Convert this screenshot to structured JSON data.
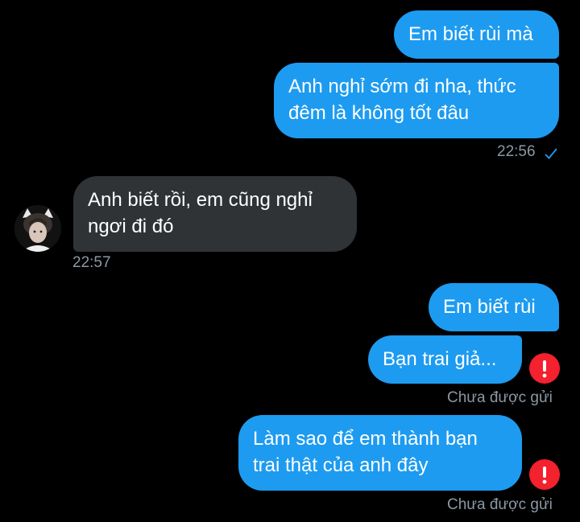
{
  "colors": {
    "background": "#000000",
    "sent_bubble": "#1d9bf0",
    "received_bubble": "#2f3336",
    "meta_text": "#8b98a5",
    "error": "#f4212e"
  },
  "messages": [
    {
      "direction": "sent",
      "text": "Em biết rùi mà"
    },
    {
      "direction": "sent",
      "lines": [
        "Anh nghỉ sớm đi nha, thức",
        "đêm là không tốt đâu"
      ],
      "time": "22:56",
      "status_icon": "check-icon"
    },
    {
      "direction": "received",
      "lines": [
        "Anh biết rồi, em cũng nghỉ",
        "ngơi đi đó"
      ],
      "time": "22:57",
      "avatar_icon": "avatar"
    },
    {
      "direction": "sent",
      "text": "Em biết rùi"
    },
    {
      "direction": "sent",
      "text": "Bạn trai giả...",
      "status": "Chưa được gửi",
      "status_icon": "error-icon"
    },
    {
      "direction": "sent",
      "lines": [
        "Làm sao để em thành bạn",
        "trai thật của anh đây"
      ],
      "status": "Chưa được gửi",
      "status_icon": "error-icon"
    }
  ]
}
